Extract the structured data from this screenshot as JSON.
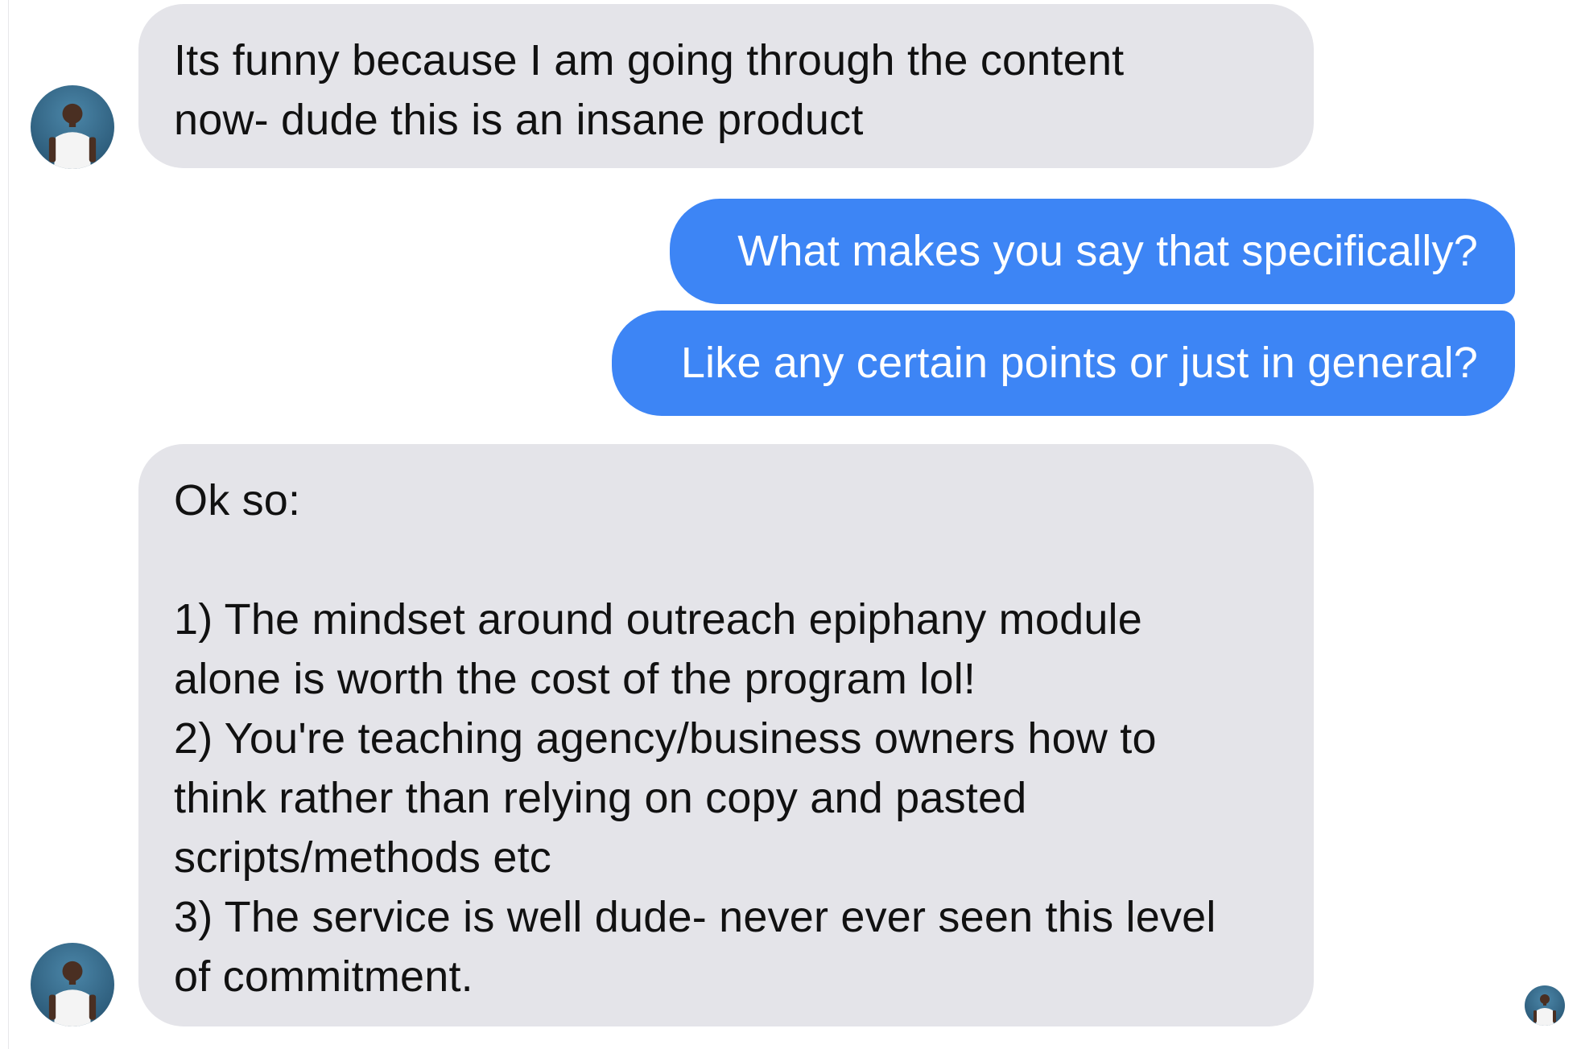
{
  "conversation": {
    "messages": [
      {
        "sender": "contact",
        "text": "Its funny because I am going through the content\nnow- dude this is an insane product"
      },
      {
        "sender": "me",
        "text": "What makes you say that specifically?"
      },
      {
        "sender": "me",
        "text": "Like any certain points or just in general?"
      },
      {
        "sender": "contact",
        "text": "Ok so:\n\n1) The mindset around outreach epiphany module\nalone is worth the cost of the program lol!\n2) You're teaching agency/business owners how to\nthink rather than relying on copy and pasted\nscripts/methods etc\n3) The service is well dude- never ever seen this level\nof commitment."
      }
    ]
  },
  "avatars": {
    "contact_icon": "contact-avatar",
    "read_receipt_icon": "seen-avatar"
  },
  "colors": {
    "incoming_bubble": "#e4e4e9",
    "outgoing_bubble": "#3d85f5",
    "incoming_text": "#111111",
    "outgoing_text": "#ffffff",
    "avatar_bg": "#2f5f7e"
  }
}
